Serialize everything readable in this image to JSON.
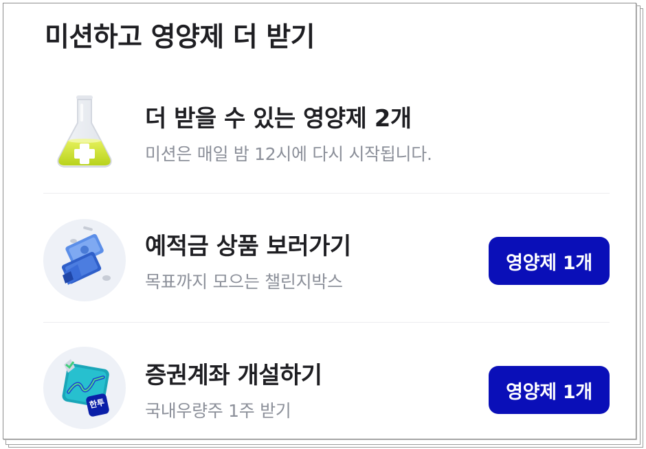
{
  "header": {
    "title": "미션하고 영양제 더 받기"
  },
  "summary": {
    "title": "더 받을 수 있는 영양제 2개",
    "subtitle": "미션은 매일 밤 12시에 다시 시작됩니다.",
    "icon": "flask-plus-icon"
  },
  "missions": [
    {
      "title": "예적금 상품 보러가기",
      "subtitle": "목표까지 모으는 챌린지박스",
      "reward_label": "영양제 1개",
      "icon": "money-bundle-icon"
    },
    {
      "title": "증권계좌 개설하기",
      "subtitle": "국내우량주 1주 받기",
      "reward_label": "영양제 1개",
      "icon": "stock-chart-icon",
      "icon_badge": "한투"
    }
  ],
  "colors": {
    "accent": "#0a0fb8",
    "title_text": "#1e1e22",
    "subtitle_text": "#8b8f99",
    "divider": "#ececef"
  }
}
